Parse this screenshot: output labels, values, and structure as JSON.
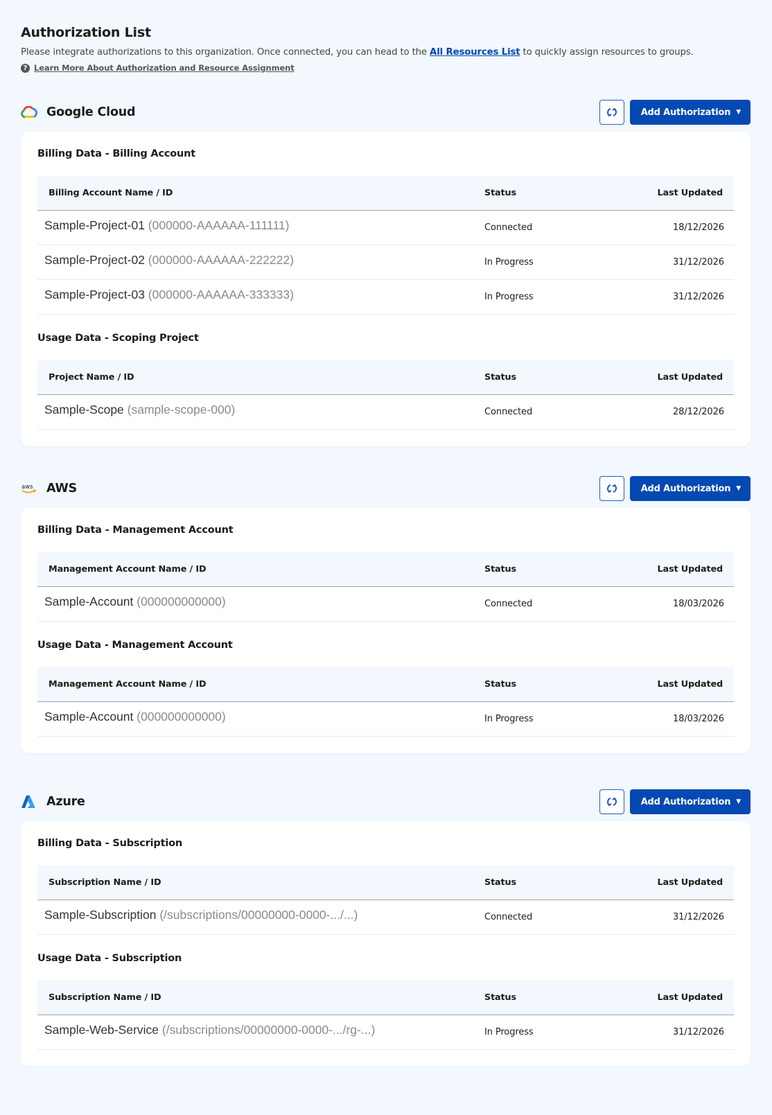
{
  "header": {
    "title": "Authorization List",
    "desc_before": "Please integrate authorizations to this organization. Once connected, you can head to the ",
    "desc_link": "All Resources List",
    "desc_after": " to quickly assign resources to groups.",
    "help_glyph": "?",
    "learn_more": "Learn More About Authorization and Resource Assignment"
  },
  "add_label": "Add Authorization",
  "caret": "▼",
  "columns": {
    "status": "Status",
    "updated": "Last Updated"
  },
  "providers": [
    {
      "name": "Google Cloud",
      "icon": "google-cloud-icon",
      "sections": [
        {
          "title": "Billing Data - Billing Account",
          "name_col": "Billing Account Name / ID",
          "rows": [
            {
              "name": "Sample-Project-01",
              "id": "(000000-AAAAAA-111111)",
              "status": "Connected",
              "updated": "18/12/2026"
            },
            {
              "name": "Sample-Project-02",
              "id": "(000000-AAAAAA-222222)",
              "status": "In Progress",
              "updated": "31/12/2026"
            },
            {
              "name": "Sample-Project-03",
              "id": "(000000-AAAAAA-333333)",
              "status": "In Progress",
              "updated": "31/12/2026"
            }
          ]
        },
        {
          "title": "Usage Data - Scoping Project",
          "name_col": "Project Name / ID",
          "rows": [
            {
              "name": "Sample-Scope",
              "id": "(sample-scope-000)",
              "status": "Connected",
              "updated": "28/12/2026"
            }
          ]
        }
      ]
    },
    {
      "name": "AWS",
      "icon": "aws-icon",
      "logo_text": "aws",
      "sections": [
        {
          "title": "Billing Data - Management Account",
          "name_col": "Management Account Name / ID",
          "rows": [
            {
              "name": "Sample-Account",
              "id": "(000000000000)",
              "status": "Connected",
              "updated": "18/03/2026"
            }
          ]
        },
        {
          "title": "Usage Data - Management Account",
          "name_col": "Management Account Name / ID",
          "rows": [
            {
              "name": "Sample-Account",
              "id": "(000000000000)",
              "status": "In Progress",
              "updated": "18/03/2026"
            }
          ]
        }
      ]
    },
    {
      "name": "Azure",
      "icon": "azure-icon",
      "sections": [
        {
          "title": "Billing Data - Subscription",
          "name_col": "Subscription Name / ID",
          "rows": [
            {
              "name": "Sample-Subscription",
              "id": "(/subscriptions/00000000-0000-.../...)",
              "status": "Connected",
              "updated": "31/12/2026"
            }
          ]
        },
        {
          "title": "Usage Data - Subscription",
          "name_col": "Subscription Name / ID",
          "rows": [
            {
              "name": "Sample-Web-Service",
              "id": "(/subscriptions/00000000-0000-.../rg-...)",
              "status": "In Progress",
              "updated": "31/12/2026"
            }
          ]
        }
      ]
    }
  ],
  "colors": {
    "primary": "#0549b3",
    "link": "#0046b8",
    "background": "#f2f8fd"
  }
}
